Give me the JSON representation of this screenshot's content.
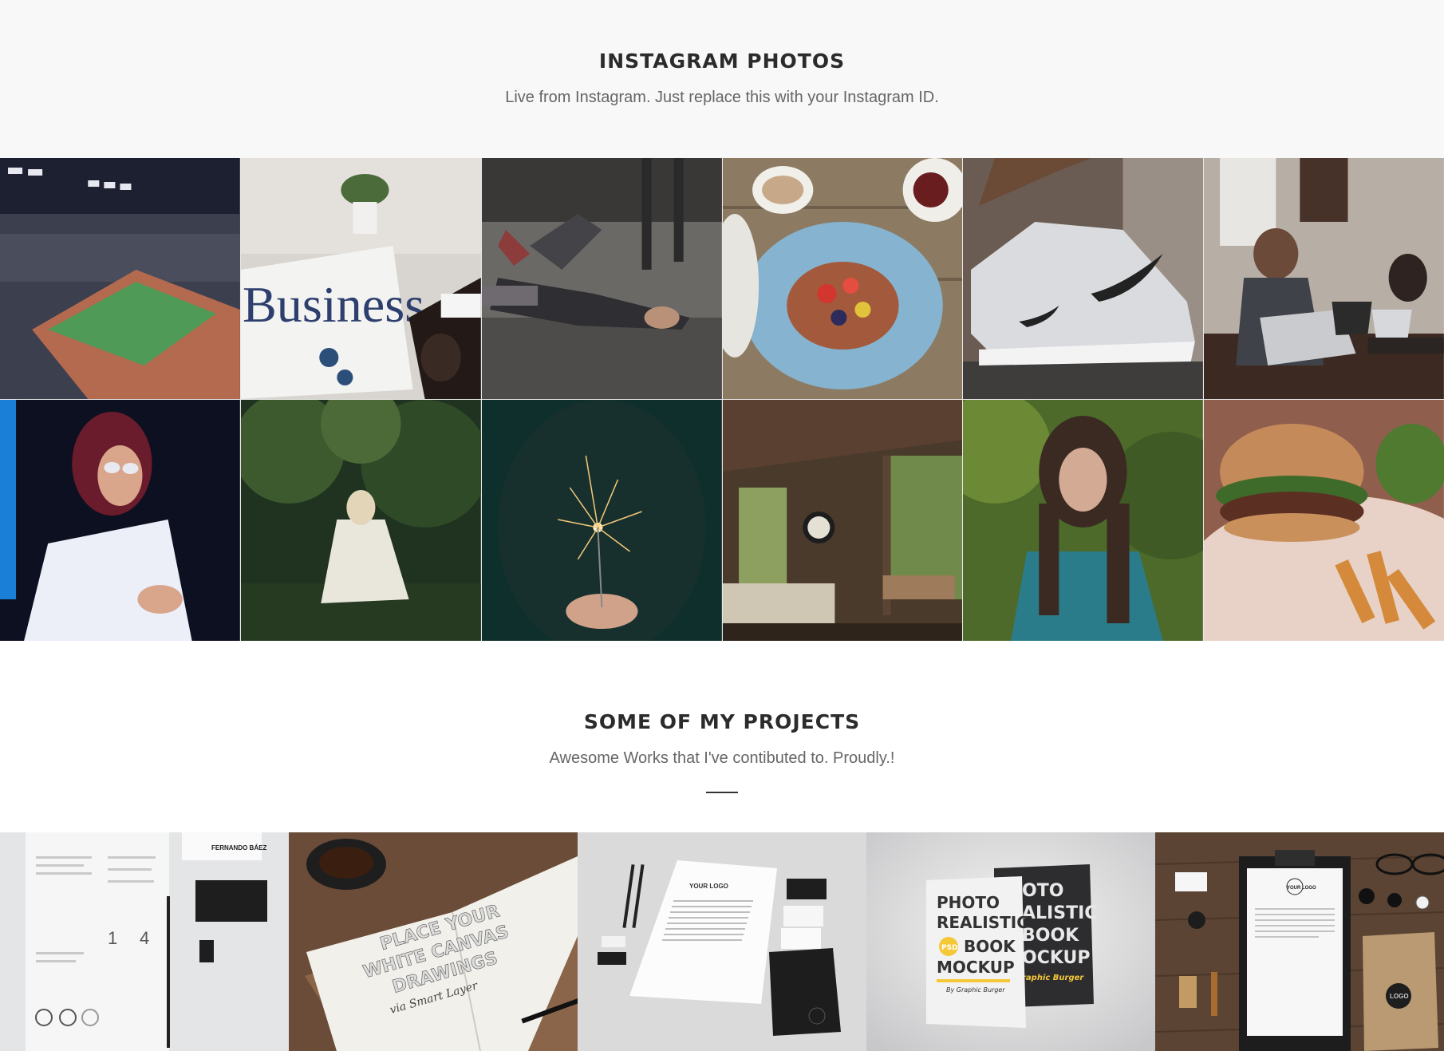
{
  "instagram": {
    "title": "INSTAGRAM PHOTOS",
    "subtitle": "Live from Instagram. Just replace this with your Instagram ID.",
    "photo_text": {
      "business_headline": "Business"
    }
  },
  "projects": {
    "title": "SOME OF MY PROJECTS",
    "subtitle": "Awesome Works that I've contibuted to. Proudly.!",
    "tiles": {
      "resume": {
        "name": "FERNANDO BÁEZ",
        "num1": "1",
        "num2": "4"
      },
      "sketch": {
        "line1": "PLACE YOUR",
        "line2": "WHITE CANVAS",
        "line3": "DRAWINGS",
        "line4": "via Smart Layer"
      },
      "stationery": {
        "logo": "YOUR LOGO"
      },
      "books": {
        "line1": "PHOTO",
        "line2": "REALISTIC",
        "line3": "BOOK",
        "line4": "MOCKUP",
        "badge": "PSD",
        "credit": "By Graphic Burger",
        "back1": "OTO",
        "back2": "ALISTIC",
        "back3": "BOOK",
        "back4": "OCKUP",
        "back5": "raphic Burger"
      },
      "clipboard": {
        "logo": "LOGO",
        "logo2": "YOUR LOGO"
      }
    }
  }
}
